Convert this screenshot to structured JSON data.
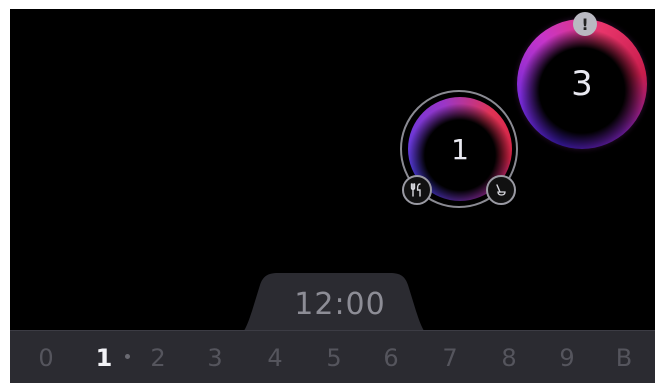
{
  "zones": {
    "large": {
      "level": "3",
      "warning_icon": "exclamation-icon",
      "warning_symbol": "!"
    },
    "small": {
      "level": "1",
      "left_icon": "cutlery-icon",
      "right_icon": "pot-icon"
    }
  },
  "clock": {
    "time": "12:00"
  },
  "power_bar": {
    "levels": [
      "0",
      "1",
      "2",
      "3",
      "4",
      "5",
      "6",
      "7",
      "8",
      "9",
      "B"
    ],
    "selected": "1"
  },
  "colors": {
    "background": "#000000",
    "bar": "#2b2b31",
    "accent_purple": "#7a2bd6",
    "accent_red": "#e8356b"
  }
}
